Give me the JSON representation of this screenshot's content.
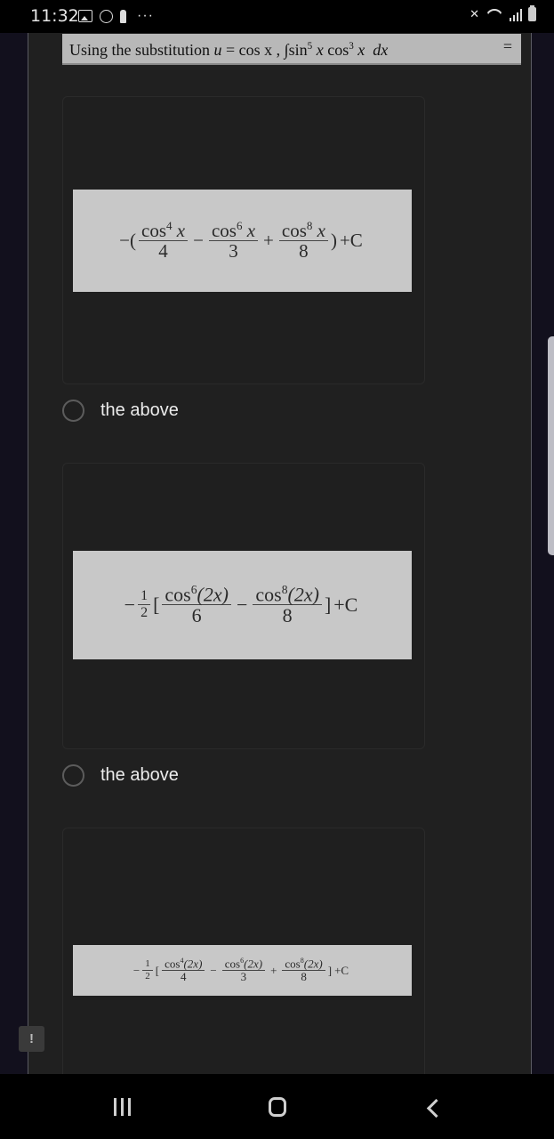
{
  "status_bar": {
    "time": "11:32",
    "left_icons": [
      "gallery-icon",
      "whatsapp-icon",
      "keyhole-icon",
      "more-notifications-icon"
    ],
    "more_label": "···",
    "right_icons": [
      "mute-icon",
      "wifi-icon",
      "signal-icon",
      "battery-icon"
    ]
  },
  "question": {
    "prefix": "Using the substitution",
    "u": "u",
    "equals": "=",
    "cos_x": "cos x ,",
    "integral": "∫",
    "sin": "sin",
    "sin_exp": "5",
    "x1": "x",
    "cos": "cos",
    "cos_exp": "3",
    "x2": "x",
    "dx": "dx",
    "trailing_equals": "="
  },
  "options": [
    {
      "formula": {
        "lead": "−(",
        "terms": [
          {
            "fn": "cos",
            "exp": "4",
            "arg": "x",
            "den": "4",
            "op_after": "−"
          },
          {
            "fn": "cos",
            "exp": "6",
            "arg": "x",
            "den": "3",
            "op_after": "+"
          },
          {
            "fn": "cos",
            "exp": "8",
            "arg": "x",
            "den": "8",
            "op_after": ""
          }
        ],
        "close": ")",
        "constant": "+C"
      },
      "label": "the above",
      "selected": false
    },
    {
      "formula": {
        "lead": "−",
        "coef_num": "1",
        "coef_den": "2",
        "open": "[",
        "terms": [
          {
            "fn": "cos",
            "exp": "6",
            "arg": "(2x)",
            "den": "6",
            "op_after": "−"
          },
          {
            "fn": "cos",
            "exp": "8",
            "arg": "(2x)",
            "den": "8",
            "op_after": ""
          }
        ],
        "close": "]",
        "constant": "+C"
      },
      "label": "the above",
      "selected": false
    },
    {
      "formula": {
        "lead": "−",
        "coef_num": "1",
        "coef_den": "2",
        "open": "[",
        "terms": [
          {
            "fn": "cos",
            "exp": "4",
            "arg": "(2x)",
            "den": "4",
            "op_after": "−"
          },
          {
            "fn": "cos",
            "exp": "6",
            "arg": "(2x)",
            "den": "3",
            "op_after": "+"
          },
          {
            "fn": "cos",
            "exp": "8",
            "arg": "(2x)",
            "den": "8",
            "op_after": ""
          }
        ],
        "close": "]",
        "constant": "+C"
      }
    }
  ],
  "feedback_button": {
    "label": "!"
  },
  "nav_bar": {
    "buttons": [
      "recent-apps",
      "home",
      "back"
    ]
  }
}
